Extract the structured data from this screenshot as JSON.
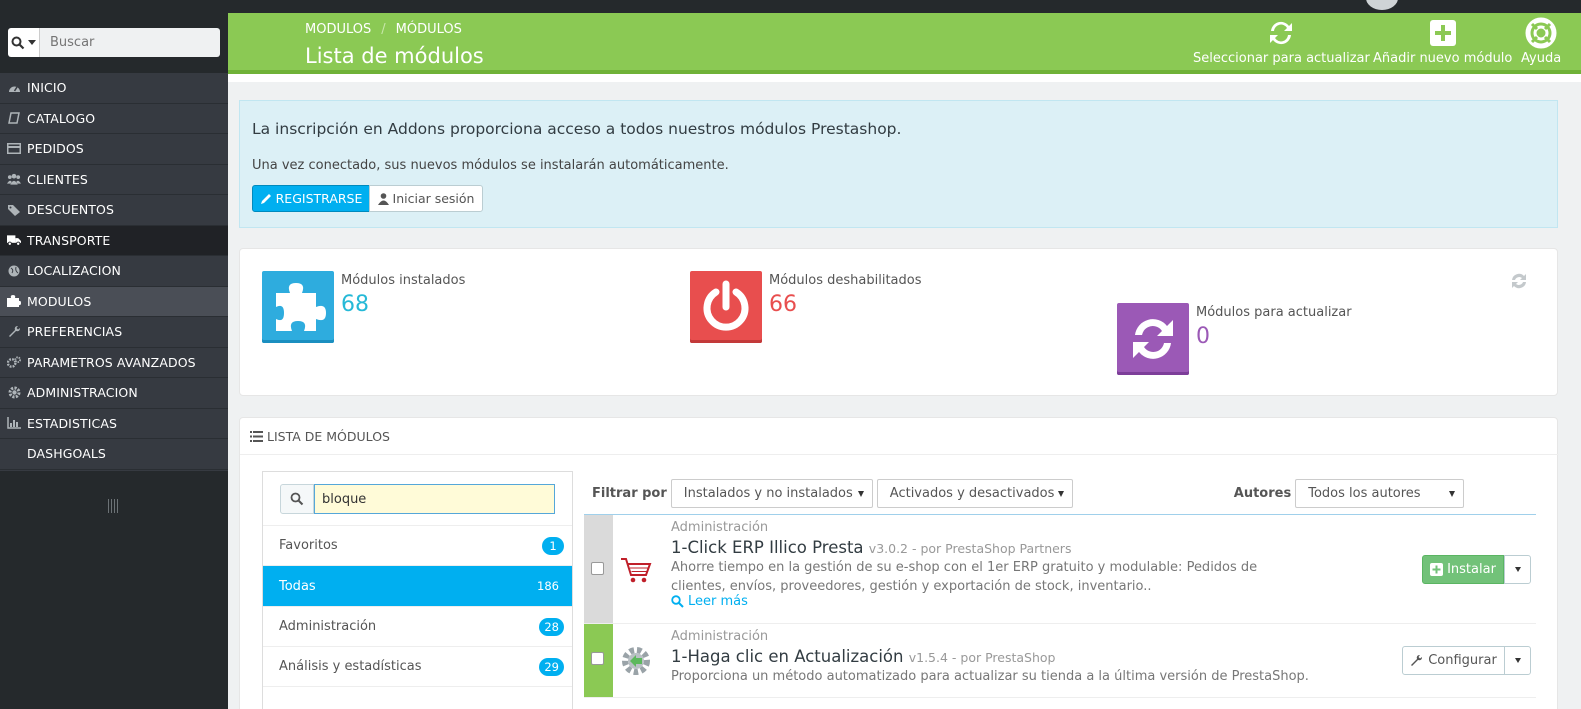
{
  "sidebar": {
    "search_placeholder": "Buscar",
    "items": [
      {
        "label": "INICIO",
        "icon": "dashboard-icon"
      },
      {
        "label": "CATALOGO",
        "icon": "book-icon"
      },
      {
        "label": "PEDIDOS",
        "icon": "credit-card-icon"
      },
      {
        "label": "CLIENTES",
        "icon": "users-icon"
      },
      {
        "label": "DESCUENTOS",
        "icon": "tags-icon"
      },
      {
        "label": "TRANSPORTE",
        "icon": "truck-icon"
      },
      {
        "label": "LOCALIZACION",
        "icon": "globe-icon"
      },
      {
        "label": "MODULOS",
        "icon": "puzzle-icon"
      },
      {
        "label": "PREFERENCIAS",
        "icon": "wrench-icon"
      },
      {
        "label": "PARAMETROS AVANZADOS",
        "icon": "cogs-icon"
      },
      {
        "label": "ADMINISTRACION",
        "icon": "cog-icon"
      },
      {
        "label": "ESTADISTICAS",
        "icon": "bar-chart-icon"
      },
      {
        "label": "DASHGOALS",
        "icon": ""
      }
    ]
  },
  "header": {
    "breadcrumb": [
      "MODULOS",
      "MÓDULOS"
    ],
    "breadcrumb_sep": "/",
    "title": "Lista de módulos",
    "actions": {
      "select_update": "Seleccionar para actualizar",
      "add_module": "Añadir nuevo módulo",
      "help": "Ayuda"
    }
  },
  "addons": {
    "title": "La inscripción en Addons proporciona acceso a todos nuestros módulos Prestashop.",
    "text": "Una vez conectado, sus nuevos módulos se instalarán automáticamente.",
    "register": "REGISTRARSE",
    "login": "Iniciar sesión"
  },
  "kpis": [
    {
      "label": "Módulos instalados",
      "value": "68",
      "color": "#25b9d7"
    },
    {
      "label": "Módulos deshabilitados",
      "value": "66",
      "color": "#e84e4e"
    },
    {
      "label": "Módulos para actualizar",
      "value": "0",
      "color": "#9b59b6"
    }
  ],
  "module_list": {
    "heading": "LISTA DE MÓDULOS",
    "search_value": "bloque",
    "categories": [
      {
        "label": "Favoritos",
        "count": "1"
      },
      {
        "label": "Todas",
        "count": "186"
      },
      {
        "label": "Administración",
        "count": "28"
      },
      {
        "label": "Análisis y estadísticas",
        "count": "29"
      }
    ],
    "filter_label": "Filtrar por",
    "filter_install": "Instalados y no instalados",
    "filter_active": "Activados y desactivados",
    "authors_label": "Autores",
    "authors_value": "Todos los autores",
    "modules": [
      {
        "category": "Administración",
        "name": "1-Click ERP Illico Presta",
        "version": "v3.0.2 - por PrestaShop Partners",
        "description": "Ahorre tiempo en la gestión de su e-shop con el 1er ERP gratuito y modulable: Pedidos de clientes, envíos, proveedores, gestión y exportación de stock, inventario..",
        "more": "Leer más",
        "action": "Instalar"
      },
      {
        "category": "Administración",
        "name": "1-Haga clic en Actualización",
        "version": "v1.5.4 - por PrestaShop",
        "description": "Proporciona un método automatizado para actualizar su tienda a la última versión de PrestaShop.",
        "action": "Configurar"
      }
    ]
  },
  "colors": {
    "accent_green": "#8bc954",
    "accent_blue": "#00aff0",
    "sidebar_bg": "#363a41"
  }
}
